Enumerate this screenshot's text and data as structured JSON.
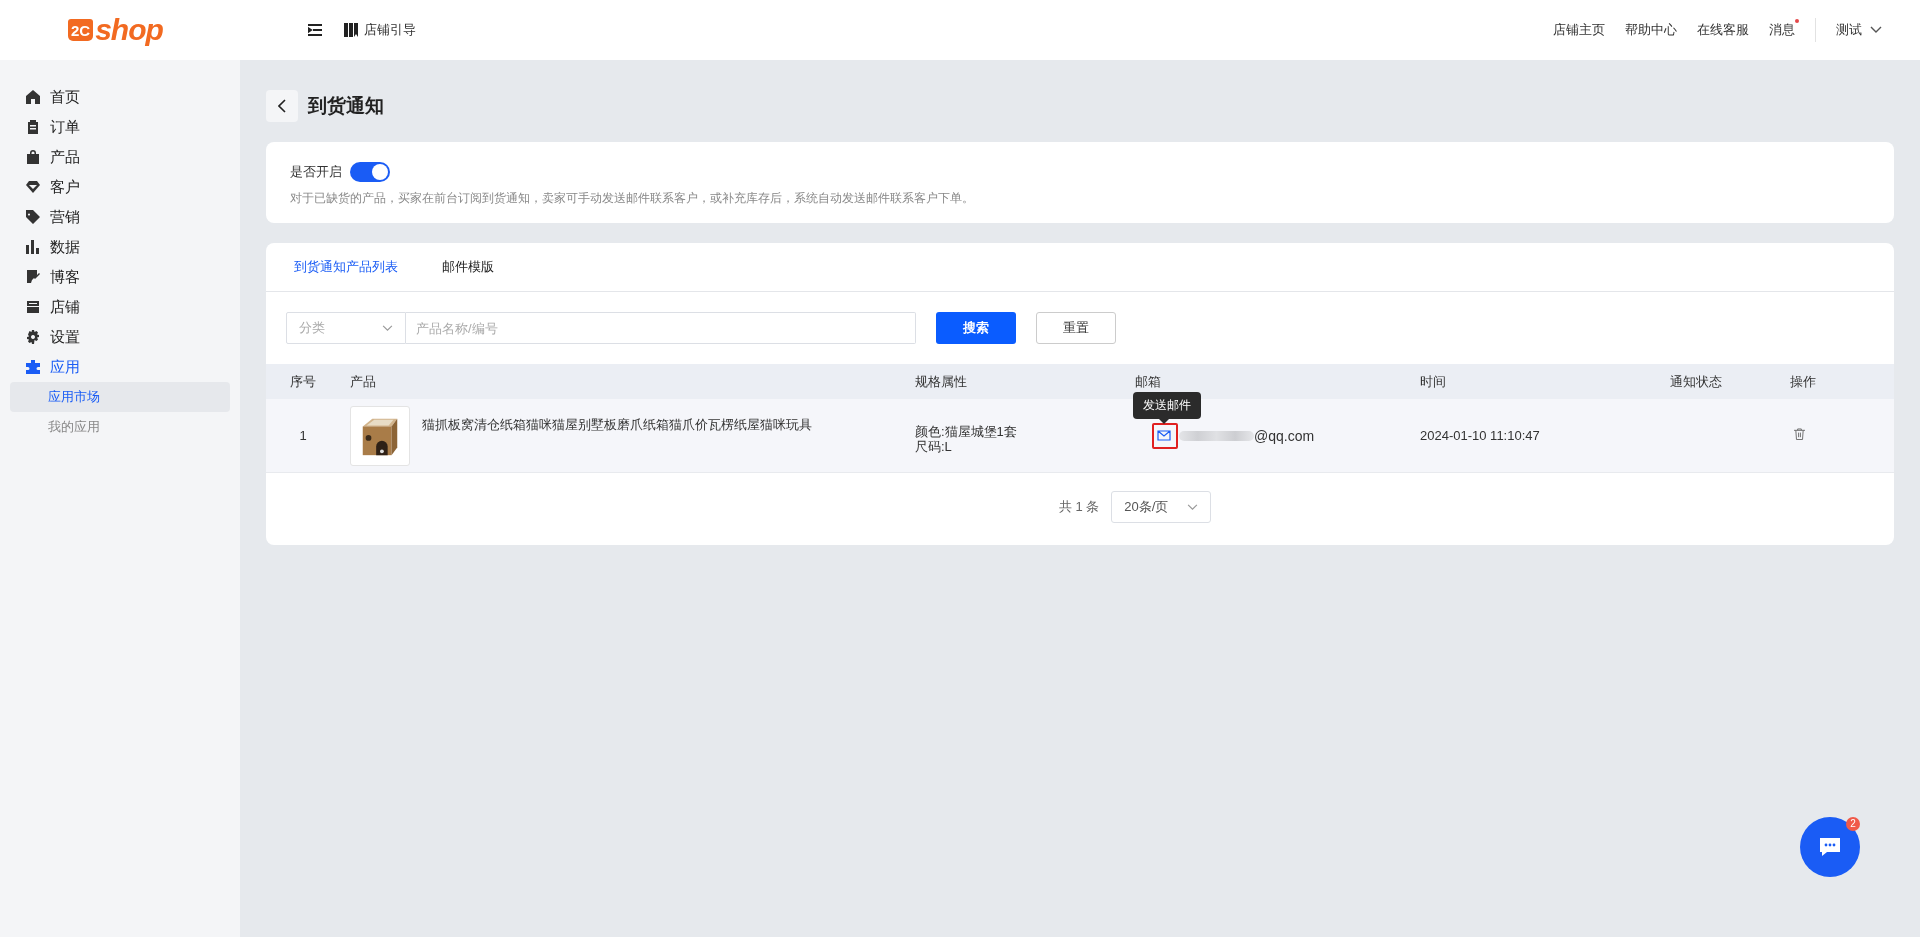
{
  "header": {
    "logo": {
      "mark": "2C",
      "text": "shop"
    },
    "guide_link": "店铺引导",
    "nav_links": [
      {
        "label": "店铺主页",
        "unread": false
      },
      {
        "label": "帮助中心",
        "unread": false
      },
      {
        "label": "在线客服",
        "unread": false
      },
      {
        "label": "消息",
        "unread": true
      }
    ],
    "user": "测试"
  },
  "sidebar": {
    "items": [
      {
        "label": "首页",
        "expanded": false
      },
      {
        "label": "订单",
        "expanded": false
      },
      {
        "label": "产品",
        "expanded": false
      },
      {
        "label": "客户",
        "expanded": false
      },
      {
        "label": "营销",
        "expanded": false
      },
      {
        "label": "数据",
        "expanded": false
      },
      {
        "label": "博客",
        "expanded": false
      },
      {
        "label": "店铺",
        "expanded": false
      },
      {
        "label": "设置",
        "expanded": false
      },
      {
        "label": "应用",
        "expanded": true,
        "children": [
          {
            "label": "应用市场",
            "selected": true
          },
          {
            "label": "我的应用",
            "selected": false
          }
        ]
      }
    ]
  },
  "page": {
    "title": "到货通知"
  },
  "settings": {
    "toggle_label": "是否开启",
    "on": true,
    "description": "对于已缺货的产品，买家在前台订阅到货通知，卖家可手动发送邮件联系客户，或补充库存后，系统自动发送邮件联系客户下单。"
  },
  "tabs": [
    {
      "label": "到货通知产品列表",
      "selected": true
    },
    {
      "label": "邮件模版",
      "selected": false
    }
  ],
  "filters": {
    "category": {
      "placeholder": "分类"
    },
    "search": {
      "placeholder": "产品名称/编号"
    },
    "buttons": [
      {
        "label": "搜索",
        "kind": "primary"
      },
      {
        "label": "重置",
        "kind": "default"
      }
    ]
  },
  "table": {
    "columns": [
      "序号",
      "产品",
      "规格属性",
      "邮箱",
      "时间",
      "通知状态",
      "操作"
    ],
    "rows": [
      {
        "index": "1",
        "product": {
          "kind": "picture",
          "name": "猫抓板窝清仓纸箱猫咪猫屋别墅板磨爪纸箱猫爪价瓦楞纸屋猫咪玩具"
        },
        "specs": [
          "颜色:猫屋城堡1套",
          "尺码:L"
        ],
        "email": "@qq.com",
        "email_redacted": true,
        "time": "2024-01-10 11:10:47",
        "highlighted": true
      }
    ]
  },
  "tooltip": "发送邮件",
  "pagination": {
    "total": "共 1 条",
    "page_size": "20条/页"
  },
  "chat": {
    "badge": "2"
  }
}
